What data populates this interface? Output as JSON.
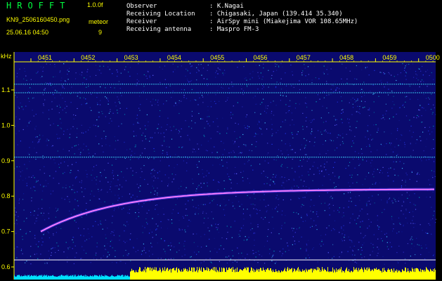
{
  "header": {
    "title": "HROFFT",
    "version": "1.0.0f",
    "filename": "KN9_2506160450.png",
    "mode": "meteor",
    "datetime": "25.06.16 04:50",
    "count": "9",
    "info": [
      {
        "label": "Observer",
        "value": ": K.Nagai"
      },
      {
        "label": "Receiving Location",
        "value": ": Chigasaki, Japan (139.414 35.340)"
      },
      {
        "label": "Receiver",
        "value": ": AirSpy mini (Miakejima VOR 108.65MHz)"
      },
      {
        "label": "Receiving antenna",
        "value": ": Maspro FM-3"
      }
    ]
  },
  "chart_data": {
    "type": "heatmap",
    "ylabel": "kHz",
    "ylim": [
      0.6,
      1.2
    ],
    "y_ticks": [
      "1.1",
      "1.0",
      "0.9",
      "0.8",
      "0.7",
      "0.6"
    ],
    "time_ticks": [
      "0451",
      "0452",
      "0453",
      "0454",
      "0455",
      "0456",
      "0457",
      "0458",
      "0459",
      "0500"
    ],
    "constant_lines_khz": [
      1.116,
      1.092,
      0.91
    ],
    "meteor_trace": {
      "start_time_min": 0.45,
      "start_khz": 0.7,
      "end_khz": 0.82
    },
    "colors": {
      "background": "#0a0a6e",
      "trace": "#ff80ff",
      "axis": "#ffff00",
      "level_bar_left": "#00e0ff",
      "level_bar_right": "#ffff00"
    }
  }
}
